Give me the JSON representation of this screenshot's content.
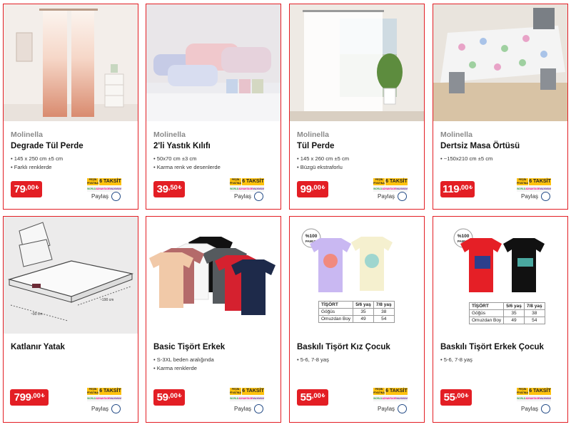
{
  "products": [
    {
      "brand": "Molinella",
      "title": "Degrade Tül Perde",
      "features": [
        "145 x 250 cm ±5 cm",
        "Farklı renklerde"
      ],
      "price_int": "79",
      "price_dec": ",00",
      "currency": "₺",
      "image": "pink-gradient-curtain"
    },
    {
      "brand": "Molinella",
      "title": "2'li Yastık Kılıfı",
      "features": [
        "50x70 cm ±3 cm",
        "Karma renk ve desenlerde"
      ],
      "price_int": "39",
      "price_dec": ",50",
      "currency": "₺",
      "image": "patterned-pillowcases"
    },
    {
      "brand": "Molinella",
      "title": "Tül Perde",
      "features": [
        "145 x 260 cm ±5 cm",
        "Büzgü ekstraforlu"
      ],
      "price_int": "99",
      "price_dec": ",00",
      "currency": "₺",
      "image": "white-tulle-curtain"
    },
    {
      "brand": "Molinella",
      "title": "Dertsiz Masa Örtüsü",
      "features": [
        "~150x210 cm ±5 cm"
      ],
      "price_int": "119",
      "price_dec": ",00",
      "currency": "₺",
      "image": "floral-tablecloth"
    },
    {
      "brand": "",
      "title": "Katlanır Yatak",
      "features": [],
      "price_int": "799",
      "price_dec": ",00",
      "currency": "₺",
      "image": "folding-mattress"
    },
    {
      "brand": "",
      "title": "Basic Tişört Erkek",
      "features": [
        "S-3XL beden aralığında",
        "Karma renklerde"
      ],
      "price_int": "59",
      "price_dec": ",00",
      "currency": "₺",
      "image": "basic-tshirts"
    },
    {
      "brand": "",
      "title": "Baskılı Tişört Kız Çocuk",
      "features": [
        "5-6, 7-8 yaş"
      ],
      "price_int": "55",
      "price_dec": ",00",
      "currency": "₺",
      "image": "girls-printed-tshirts"
    },
    {
      "brand": "",
      "title": "Baskılı Tişört Erkek Çocuk",
      "features": [
        "5-6, 7-8 yaş"
      ],
      "price_int": "55",
      "price_dec": ",00",
      "currency": "₺",
      "image": "boys-printed-tshirts"
    }
  ],
  "installment": {
    "pesin": "PEŞİN FİYATINA",
    "count": "6 TAKSİT",
    "banks": [
      "WORLD",
      "ADVANTAGE",
      "MAXIMUM"
    ]
  },
  "share_label": "Paylaş",
  "badge": {
    "line1": "%100",
    "line2": "PAMUK"
  },
  "mattress_dims": {
    "width": "~90 cm",
    "length": "~190 cm"
  },
  "size_table_girl": {
    "headers": [
      "TİŞÖRT",
      "5/6 yaş",
      "7/8 yaş"
    ],
    "rows": [
      [
        "Göğüs",
        "35",
        "38"
      ],
      [
        "Omuzdan Boy",
        "49",
        "54"
      ]
    ]
  },
  "size_table_boy": {
    "headers": [
      "TİŞÖRT",
      "5/6 yaş",
      "7/8 yaş"
    ],
    "rows": [
      [
        "Göğüs",
        "35",
        "38"
      ],
      [
        "Omuzdan Boy",
        "49",
        "54"
      ]
    ]
  },
  "colors": {
    "accent": "#e31e24",
    "taksit": "#ffc20e",
    "share_ring": "#234b86"
  }
}
